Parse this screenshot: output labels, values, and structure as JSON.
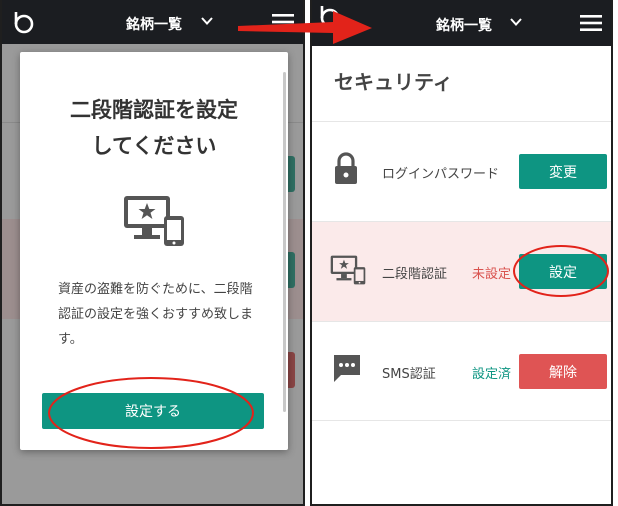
{
  "left": {
    "header": {
      "title": "銘柄一覧"
    },
    "modal": {
      "title_line1": "二段階認証を設定",
      "title_line2": "してください",
      "body": "資産の盗難を防ぐために、二段階認証の設定を強くおすすめ致します。",
      "button": "設定する"
    }
  },
  "right": {
    "header": {
      "title": "銘柄一覧"
    },
    "section_title": "セキュリティ",
    "rows": [
      {
        "label": "ログインパスワード",
        "status": "",
        "button": "変更",
        "button_color": "#0e9582",
        "icon": "lock-icon"
      },
      {
        "label": "二段階認証",
        "status": "未設定",
        "status_color": "#d9534f",
        "button": "設定",
        "button_color": "#0e9582",
        "icon": "device-star-icon"
      },
      {
        "label": "SMS認証",
        "status": "設定済",
        "status_color": "#0e9582",
        "button": "解除",
        "button_color": "#df5454",
        "icon": "chat-bubble-icon"
      }
    ]
  },
  "colors": {
    "primary": "#0e9582",
    "danger": "#df5454",
    "header": "#1b1d21",
    "highlight": "#fbeaea",
    "annotation": "#e2231a"
  }
}
